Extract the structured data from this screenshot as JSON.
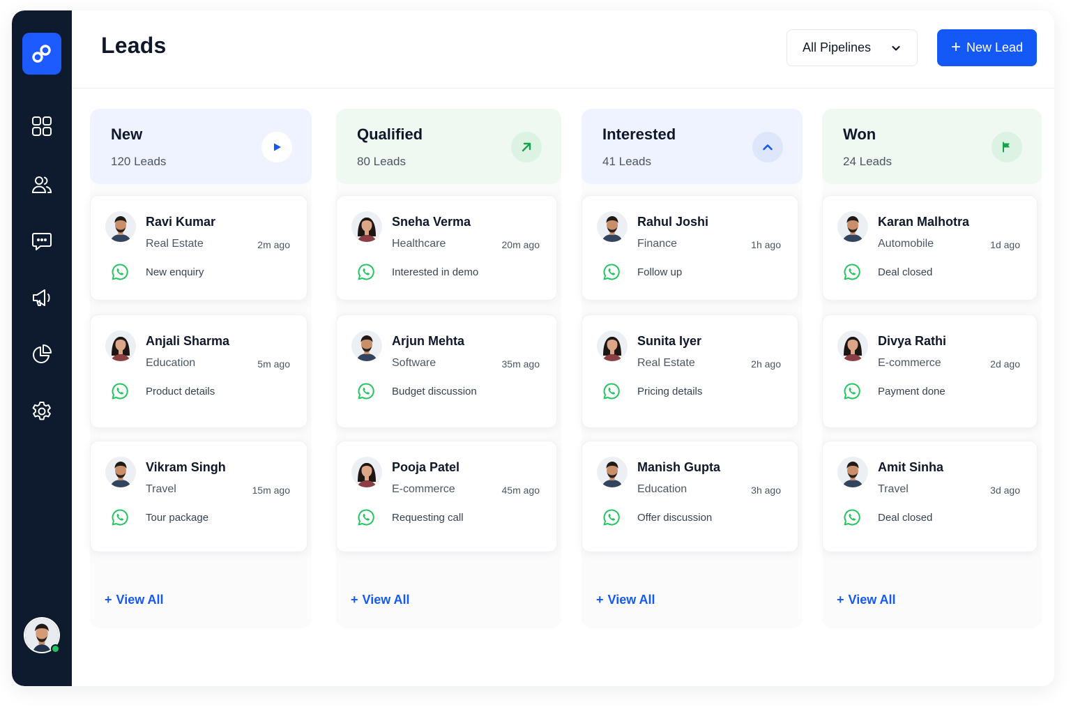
{
  "header": {
    "title": "Leads",
    "pipeline_select": "All Pipelines",
    "new_lead_label": "New Lead"
  },
  "sidebar": {
    "items": [
      {
        "icon": "dashboard-grid-icon"
      },
      {
        "icon": "users-icon"
      },
      {
        "icon": "chat-icon"
      },
      {
        "icon": "megaphone-icon"
      },
      {
        "icon": "pie-chart-icon"
      },
      {
        "icon": "settings-icon"
      }
    ]
  },
  "columns": [
    {
      "title": "New",
      "count": "120 Leads",
      "icon": "play-icon",
      "header_bg": "#eef3ff",
      "icon_bg": "#ffffff",
      "icon_color": "#1458f5",
      "view_all": "View All",
      "leads": [
        {
          "name": "Ravi Kumar",
          "industry": "Real Estate",
          "time": "2m ago",
          "message": "New enquiry",
          "gender": "m"
        },
        {
          "name": "Anjali Sharma",
          "industry": "Education",
          "time": "5m ago",
          "message": "Product details",
          "gender": "f"
        },
        {
          "name": "Vikram Singh",
          "industry": "Travel",
          "time": "15m ago",
          "message": "Tour package",
          "gender": "m"
        }
      ]
    },
    {
      "title": "Qualified",
      "count": "80 Leads",
      "icon": "arrow-up-right-icon",
      "header_bg": "#eff8f1",
      "icon_bg": "#dcf3e3",
      "icon_color": "#16a34a",
      "view_all": "View All",
      "leads": [
        {
          "name": "Sneha Verma",
          "industry": "Healthcare",
          "time": "20m ago",
          "message": "Interested in demo",
          "gender": "f"
        },
        {
          "name": "Arjun Mehta",
          "industry": "Software",
          "time": "35m ago",
          "message": "Budget discussion",
          "gender": "m"
        },
        {
          "name": "Pooja Patel",
          "industry": "E-commerce",
          "time": "45m ago",
          "message": "Requesting call",
          "gender": "f"
        }
      ]
    },
    {
      "title": "Interested",
      "count": "41 Leads",
      "icon": "chevron-up-icon",
      "header_bg": "#eef3ff",
      "icon_bg": "#dde6fb",
      "icon_color": "#1458f5",
      "view_all": "View All",
      "leads": [
        {
          "name": "Rahul Joshi",
          "industry": "Finance",
          "time": "1h ago",
          "message": "Follow up",
          "gender": "m"
        },
        {
          "name": "Sunita Iyer",
          "industry": "Real Estate",
          "time": "2h ago",
          "message": "Pricing details",
          "gender": "f"
        },
        {
          "name": "Manish Gupta",
          "industry": "Education",
          "time": "3h ago",
          "message": "Offer discussion",
          "gender": "m"
        }
      ]
    },
    {
      "title": "Won",
      "count": "24 Leads",
      "icon": "flag-icon",
      "header_bg": "#eff8f1",
      "icon_bg": "#dcf3e3",
      "icon_color": "#16a34a",
      "view_all": "View All",
      "leads": [
        {
          "name": "Karan Malhotra",
          "industry": "Automobile",
          "time": "1d ago",
          "message": "Deal closed",
          "gender": "m"
        },
        {
          "name": "Divya Rathi",
          "industry": "E-commerce",
          "time": "2d ago",
          "message": "Payment done",
          "gender": "f"
        },
        {
          "name": "Amit Sinha",
          "industry": "Travel",
          "time": "3d ago",
          "message": "Deal closed",
          "gender": "m"
        }
      ]
    }
  ],
  "colors": {
    "sidebar_bg": "#0e1a2e",
    "accent": "#1458f5",
    "whatsapp": "#22c55e",
    "online": "#22c55e"
  }
}
